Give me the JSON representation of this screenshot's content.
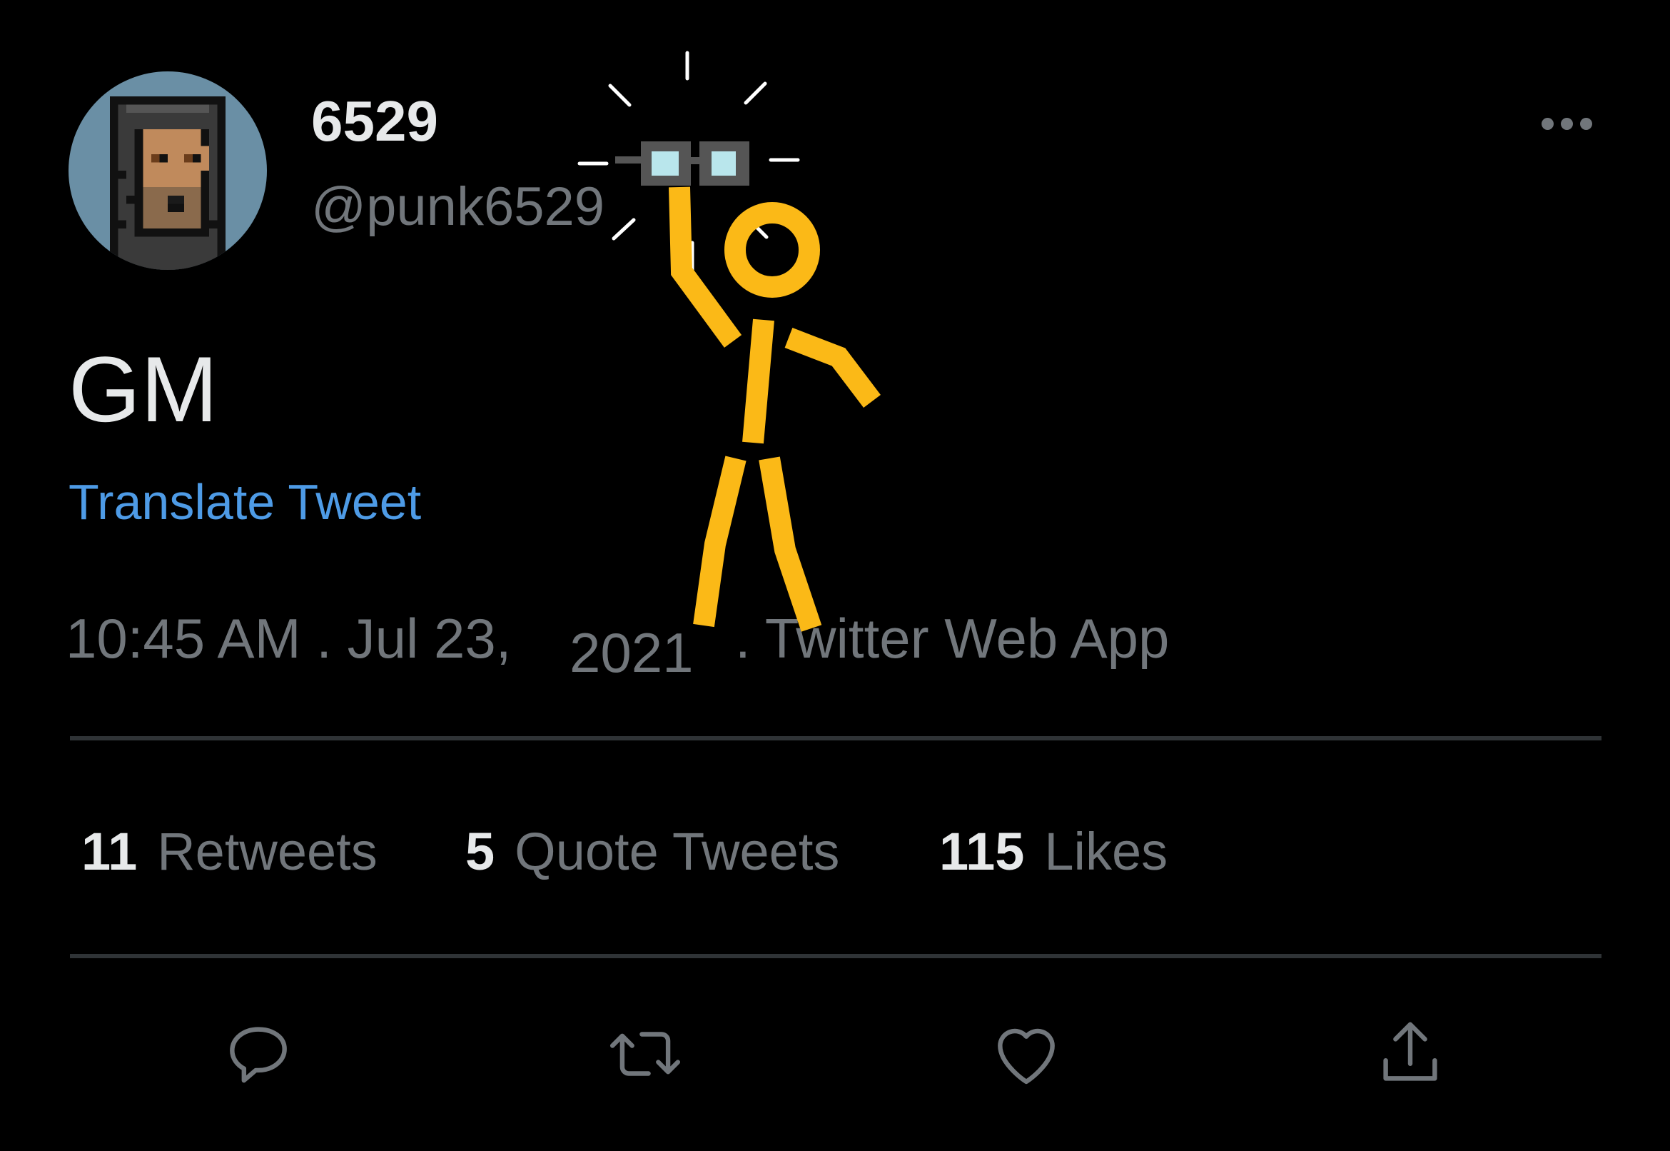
{
  "author": {
    "display_name": "6529",
    "handle": "@punk6529",
    "avatar_icon": "cryptopunk-avatar"
  },
  "tweet": {
    "text": "GM",
    "translate_label": "Translate Tweet"
  },
  "meta": {
    "time_date": "10:45 AM . Jul 23,",
    "year": "2021",
    "source": ". Twitter Web App"
  },
  "stats": {
    "retweets": {
      "count": "11",
      "label": "Retweets"
    },
    "quotes": {
      "count": "5",
      "label": "Quote Tweets"
    },
    "likes": {
      "count": "115",
      "label": "Likes"
    }
  },
  "actions": [
    {
      "icon": "reply-icon"
    },
    {
      "icon": "retweet-icon"
    },
    {
      "icon": "like-icon"
    },
    {
      "icon": "share-icon"
    }
  ],
  "colors": {
    "background": "#000000",
    "text_primary": "#e7e9ea",
    "text_secondary": "#71767b",
    "link": "#4e9be6",
    "divider": "#2f3336",
    "stick_figure": "#fbb917"
  }
}
